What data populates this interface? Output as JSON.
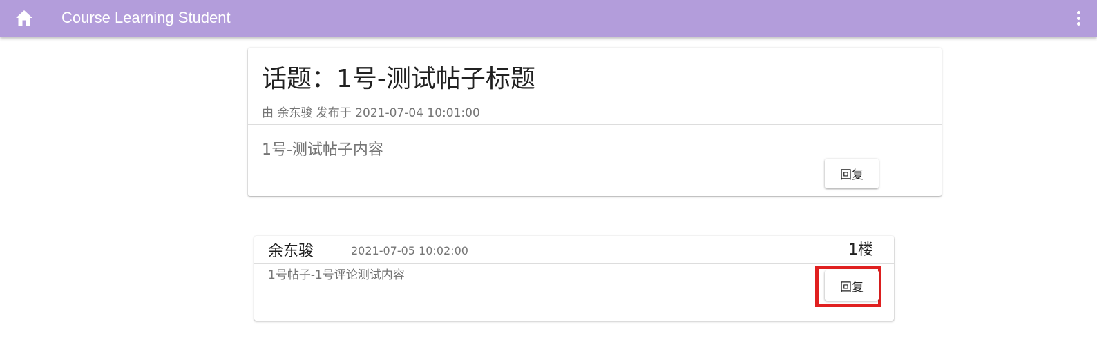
{
  "app_bar": {
    "title": "Course Learning Student",
    "home_icon": "home-icon",
    "menu_icon": "more-vert-icon",
    "color": "#b39ddb"
  },
  "topic": {
    "title": "话题：1号-测试帖子标题",
    "meta": "由 余东骏 发布于 2021-07-04 10:01:00",
    "body": "1号-测试帖子内容",
    "reply_label": "回复"
  },
  "comments": [
    {
      "author": "余东骏",
      "time": "2021-07-05 10:02:00",
      "floor": "1楼",
      "body": "1号帖子-1号评论测试内容",
      "reply_label": "回复",
      "highlight_color": "#e02020"
    }
  ]
}
